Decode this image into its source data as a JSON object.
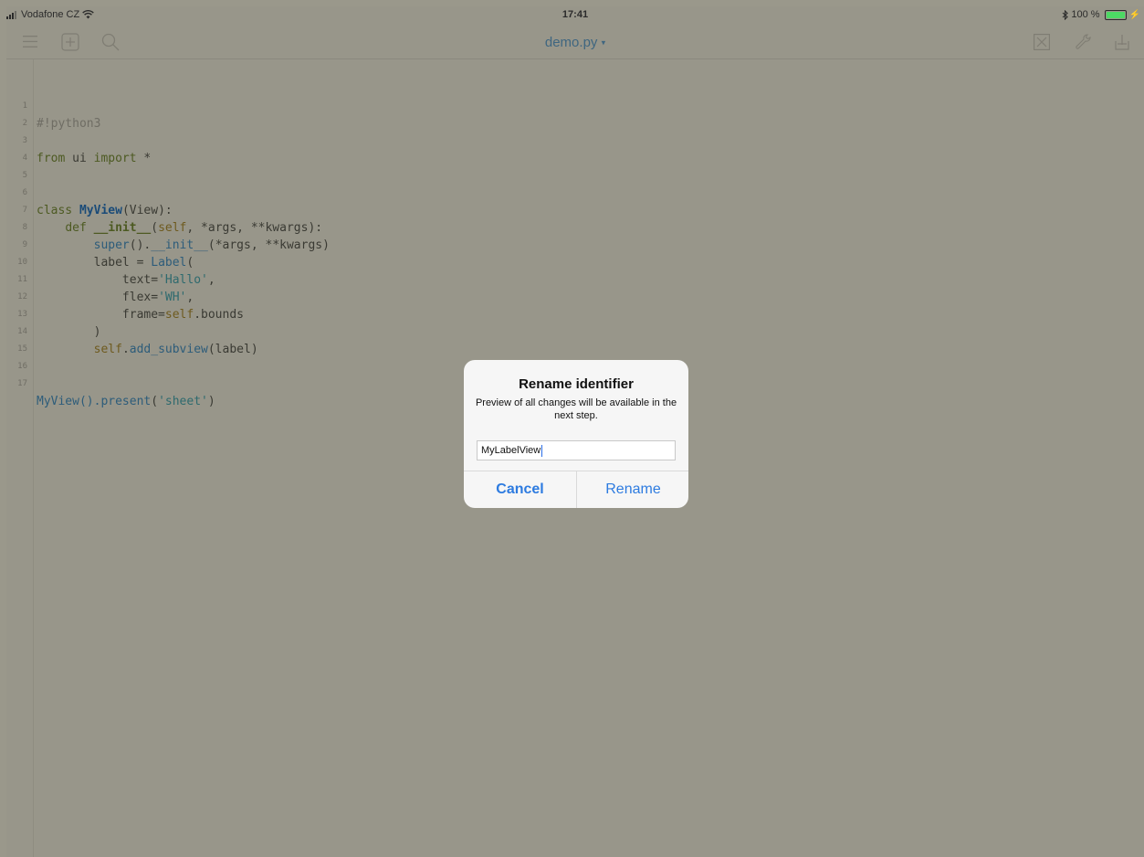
{
  "status_bar": {
    "carrier": "Vodafone CZ",
    "time": "17:41",
    "battery_text": "100 %"
  },
  "toolbar": {
    "title": "demo.py",
    "icons": [
      "menu-icon",
      "add-file-icon",
      "search-icon",
      "close-icon",
      "wrench-icon",
      "share-icon"
    ]
  },
  "editor": {
    "line_numbers": [
      "1",
      "2",
      "3",
      "4",
      "5",
      "6",
      "7",
      "8",
      "9",
      "10",
      "11",
      "12",
      "13",
      "14",
      "15",
      "16",
      "17"
    ],
    "code": {
      "l1": "#!python3",
      "l3_from": "from",
      "l3_mod": " ui ",
      "l3_import": "import",
      "l3_rest": " *",
      "l6_class": "class ",
      "l6_name": "MyView",
      "l6_rest": "(View):",
      "l7_def": "def ",
      "l7_name": "__init__",
      "l7_open": "(",
      "l7_self": "self",
      "l7_rest": ", *args, **kwargs):",
      "l8_super": "super",
      "l8_dot": "().",
      "l8_init": "__init__",
      "l8_rest": "(*args, **kwargs)",
      "l9_a": "label = ",
      "l9_label": "Label",
      "l9_b": "(",
      "l10_a": "text=",
      "l10_s": "'Hallo'",
      "l10_b": ",",
      "l11_a": "flex=",
      "l11_s": "'WH'",
      "l11_b": ",",
      "l12_a": "frame=",
      "l12_self": "self",
      "l12_b": ".bounds",
      "l13": ")",
      "l14_self": "self",
      "l14_dot": ".",
      "l14_fn": "add_subview",
      "l14_rest": "(label)",
      "l17_a": "MyView().",
      "l17_fn": "present",
      "l17_b": "(",
      "l17_s": "'sheet'",
      "l17_c": ")"
    }
  },
  "dialog": {
    "title": "Rename identifier",
    "message": "Preview of all changes will be available in the next step.",
    "input_value": "MyLabelView",
    "cancel_label": "Cancel",
    "rename_label": "Rename"
  },
  "colors": {
    "accent": "#2d7be0",
    "overlay_bg": "#98968a"
  }
}
